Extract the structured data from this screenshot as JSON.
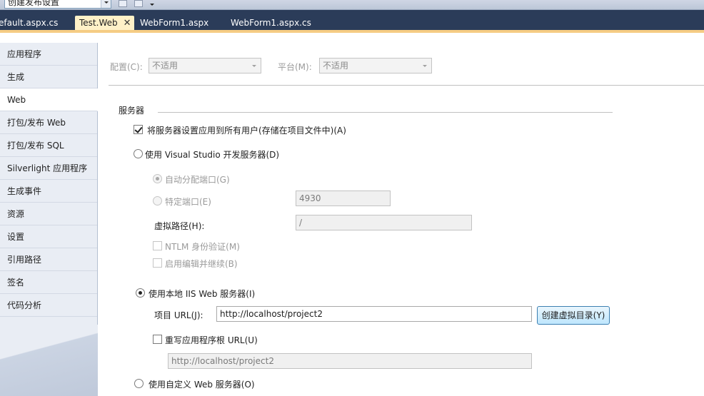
{
  "toolbar": {
    "combo_value": "创建发布设置"
  },
  "tabs": [
    {
      "label": "efault.aspx.cs"
    },
    {
      "label": "Test.Web",
      "close": "✕"
    },
    {
      "label": "WebForm1.aspx"
    },
    {
      "label": "WebForm1.aspx.cs"
    }
  ],
  "sidebar": {
    "items": [
      {
        "label": "应用程序"
      },
      {
        "label": "生成"
      },
      {
        "label": "Web"
      },
      {
        "label": "打包/发布 Web"
      },
      {
        "label": "打包/发布 SQL"
      },
      {
        "label": "Silverlight 应用程序"
      },
      {
        "label": "生成事件"
      },
      {
        "label": "资源"
      },
      {
        "label": "设置"
      },
      {
        "label": "引用路径"
      },
      {
        "label": "签名"
      },
      {
        "label": "代码分析"
      }
    ],
    "active": "Web"
  },
  "config": {
    "config_label": "配置(C):",
    "config_value": "不适用",
    "platform_label": "平台(M):",
    "platform_value": "不适用"
  },
  "servers": {
    "section_title": "服务器",
    "apply_all_label": "将服务器设置应用到所有用户(存储在项目文件中)(A)",
    "apply_all_checked": true,
    "vs_server_label": "使用 Visual Studio 开发服务器(D)",
    "auto_port_label": "自动分配端口(G)",
    "specific_port_label": "特定端口(E)",
    "specific_port_value": "4930",
    "virtual_path_label": "虚拟路径(H):",
    "virtual_path_value": "/",
    "ntlm_label": "NTLM 身份验证(M)",
    "edit_continue_label": "启用编辑并继续(B)",
    "iis_label": "使用本地 IIS Web 服务器(I)",
    "project_url_label": "项目 URL(J):",
    "project_url_value": "http://localhost/project2",
    "create_vdir_button": "创建虚拟目录(Y)",
    "override_root_label": "重写应用程序根 URL(U)",
    "override_root_value": "http://localhost/project2",
    "custom_server_label": "使用自定义 Web 服务器(O)",
    "selected_server": "iis"
  }
}
